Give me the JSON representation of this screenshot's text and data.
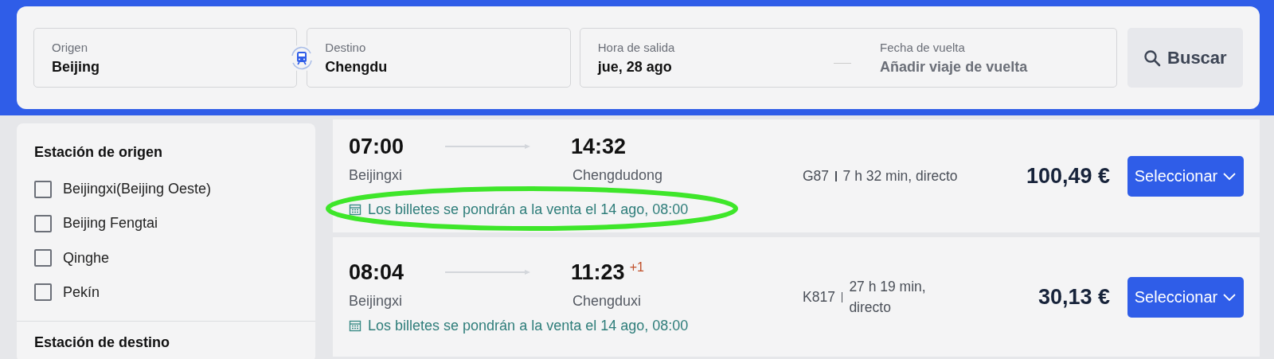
{
  "search": {
    "origin": {
      "label": "Origen",
      "value": "Beijing"
    },
    "destination": {
      "label": "Destino",
      "value": "Chengdu"
    },
    "departure": {
      "label": "Hora de salida",
      "value": "jue, 28 ago"
    },
    "return": {
      "label": "Fecha de vuelta",
      "placeholder": "Añadir viaje de vuelta"
    },
    "search_button": "Buscar"
  },
  "filters": {
    "title": "Estación de origen",
    "options": [
      {
        "label": "Beijingxi(Beijing Oeste)",
        "checked": false
      },
      {
        "label": "Beijing Fengtai",
        "checked": false
      },
      {
        "label": "Qinghe",
        "checked": false
      },
      {
        "label": "Pekín",
        "checked": false
      }
    ],
    "next_title": "Estación de destino"
  },
  "results": [
    {
      "depart_time": "07:00",
      "arrive_time": "14:32",
      "from": "Beijingxi",
      "to": "Chengdudong",
      "notice": "Los billetes se pondrán a la venta el 14 ago, 08:00",
      "train": "G87",
      "duration": "7 h 32 min, directo",
      "price": "100,49 €",
      "button": "Seleccionar",
      "highlighted": true
    },
    {
      "depart_time": "08:04",
      "arrive_time": "11:23",
      "day_offset": "+1",
      "from": "Beijingxi",
      "to": "Chengduxi",
      "notice": "Los billetes se pondrán a la venta el 14 ago, 08:00",
      "train": "K817",
      "duration": "27 h 19 min,\ndirecto",
      "price": "30,13 €",
      "button": "Seleccionar",
      "highlighted": false
    }
  ]
}
